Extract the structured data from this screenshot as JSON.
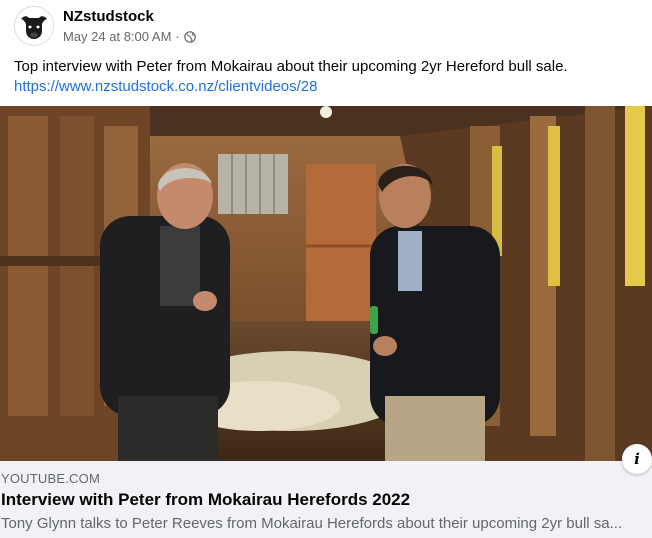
{
  "post": {
    "page_name": "NZstudstock",
    "date": "May 24 at 8:00 AM",
    "separator": "·",
    "audience_icon": "globe-icon",
    "text": "Top interview with Peter from Mokairau about their upcoming 2yr Hereford bull sale.",
    "link": "https://www.nzstudstock.co.nz/clientvideos/28"
  },
  "link_card": {
    "domain": "YOUTUBE.COM",
    "title": "Interview with Peter from Mokairau Herefords 2022",
    "description": "Tony Glynn talks to Peter Reeves from Mokairau Herefords about their upcoming 2yr bull sa...",
    "info_icon": "info-icon",
    "info_glyph": "i"
  },
  "colors": {
    "link": "#216fdb",
    "secondary_text": "#65676b",
    "card_bg": "#f0f2f5"
  }
}
